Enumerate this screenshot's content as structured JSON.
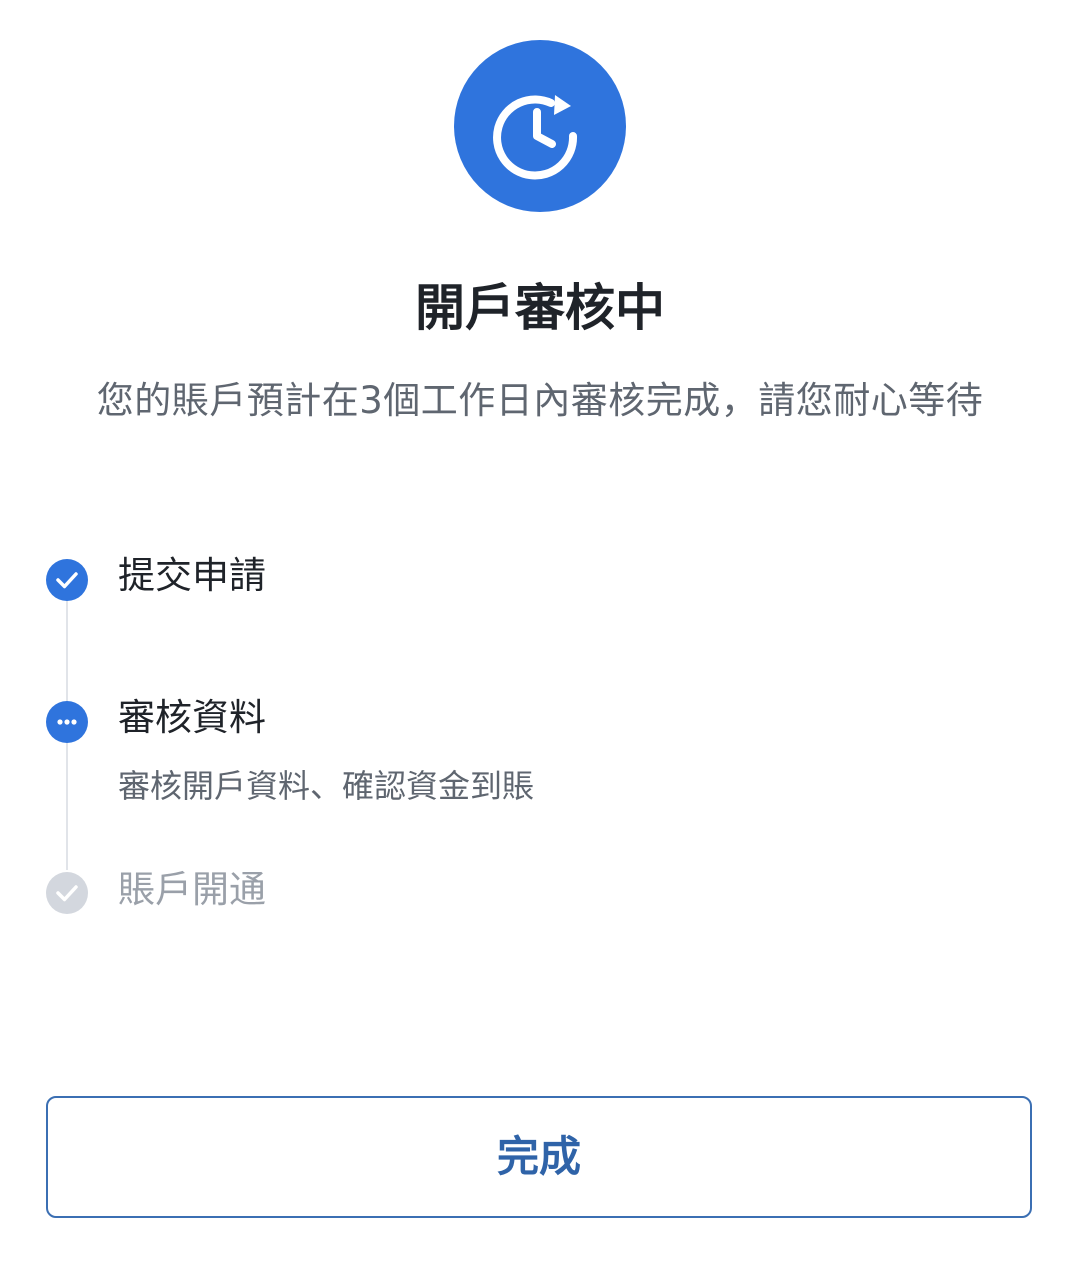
{
  "status": {
    "icon": "clock-refresh-icon",
    "title": "開戶審核中",
    "subtitle": "您的賬戶預計在3個工作日內審核完成，請您耐心等待"
  },
  "steps": [
    {
      "label": "提交申請",
      "state": "done",
      "icon": "check-icon",
      "description": ""
    },
    {
      "label": "審核資料",
      "state": "in-progress",
      "icon": "more-dots-icon",
      "description": "審核開戶資料、確認資金到賬"
    },
    {
      "label": "賬戶開通",
      "state": "pending",
      "icon": "check-icon",
      "description": ""
    }
  ],
  "actions": {
    "done_label": "完成"
  },
  "colors": {
    "accent": "#2f74dd",
    "pending": "#d3d7de",
    "button_text": "#2f63a8",
    "button_border": "#3b6fb3"
  }
}
